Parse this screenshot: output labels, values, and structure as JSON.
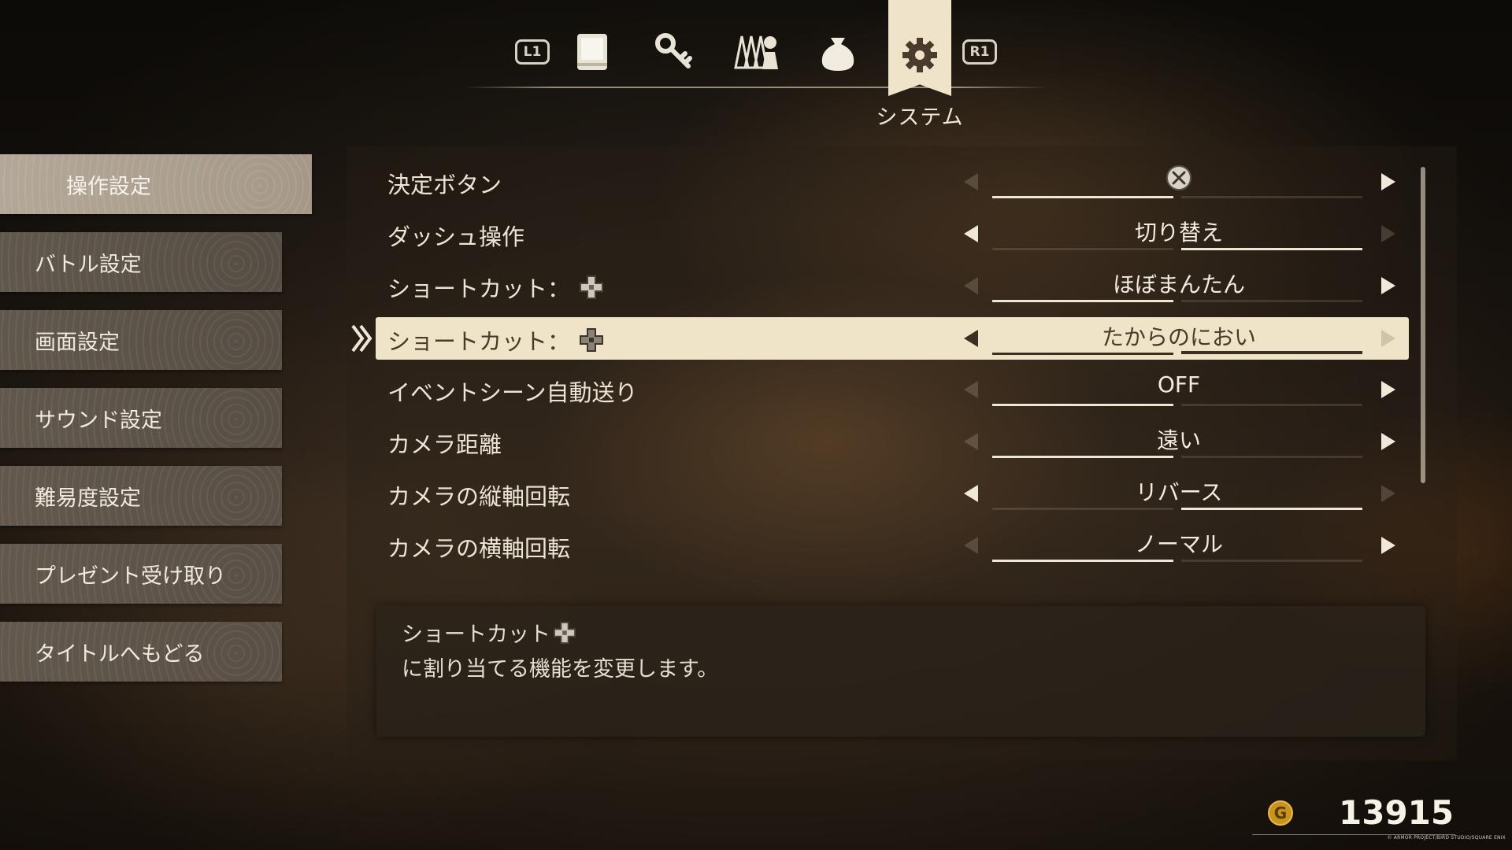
{
  "top_tabs": {
    "left_shoulder": "L1",
    "right_shoulder": "R1",
    "icons": [
      "book-icon",
      "key-icon",
      "party-icon",
      "bag-icon",
      "gear-icon"
    ],
    "active_label": "システム"
  },
  "sidebar": {
    "items": [
      {
        "label": "操作設定",
        "active": true
      },
      {
        "label": "バトル設定"
      },
      {
        "label": "画面設定"
      },
      {
        "label": "サウンド設定"
      },
      {
        "label": "難易度設定"
      },
      {
        "label": "プレゼント受け取り"
      },
      {
        "label": "タイトルへもどる"
      }
    ]
  },
  "settings": {
    "rows": [
      {
        "label": "決定ボタン",
        "value": "",
        "value_icon": "cross-button-icon",
        "selected_index": 0,
        "option_count": 2
      },
      {
        "label": "ダッシュ操作",
        "value": "切り替え",
        "selected_index": 1,
        "option_count": 2
      },
      {
        "label": "ショートカット：",
        "label_icon": "dpad-icon",
        "value": "ほぼまんたん",
        "selected_index": 0,
        "option_count": 2
      },
      {
        "label": "ショートカット：",
        "label_icon": "dpad-icon",
        "value": "たからのにおい",
        "selected_index": 1,
        "option_count": 2,
        "selected": true
      },
      {
        "label": "イベントシーン自動送り",
        "value": "OFF",
        "selected_index": 0,
        "option_count": 2
      },
      {
        "label": "カメラ距離",
        "value": "遠い",
        "selected_index": 0,
        "option_count": 2
      },
      {
        "label": "カメラの縦軸回転",
        "value": "リバース",
        "selected_index": 1,
        "option_count": 2
      },
      {
        "label": "カメラの横軸回転",
        "value": "ノーマル",
        "selected_index": 0,
        "option_count": 2
      }
    ]
  },
  "description": {
    "title": "ショートカット",
    "title_icon": "dpad-icon",
    "body": "に割り当てる機能を変更します。"
  },
  "gold": {
    "icon_letter": "G",
    "amount": "13915"
  },
  "copyright": "© ARMOR PROJECT/BIRD STUDIO/SQUARE ENIX",
  "colors": {
    "highlight": "#efe4c8",
    "text": "#ece5d5",
    "gold": "#c8941e"
  }
}
